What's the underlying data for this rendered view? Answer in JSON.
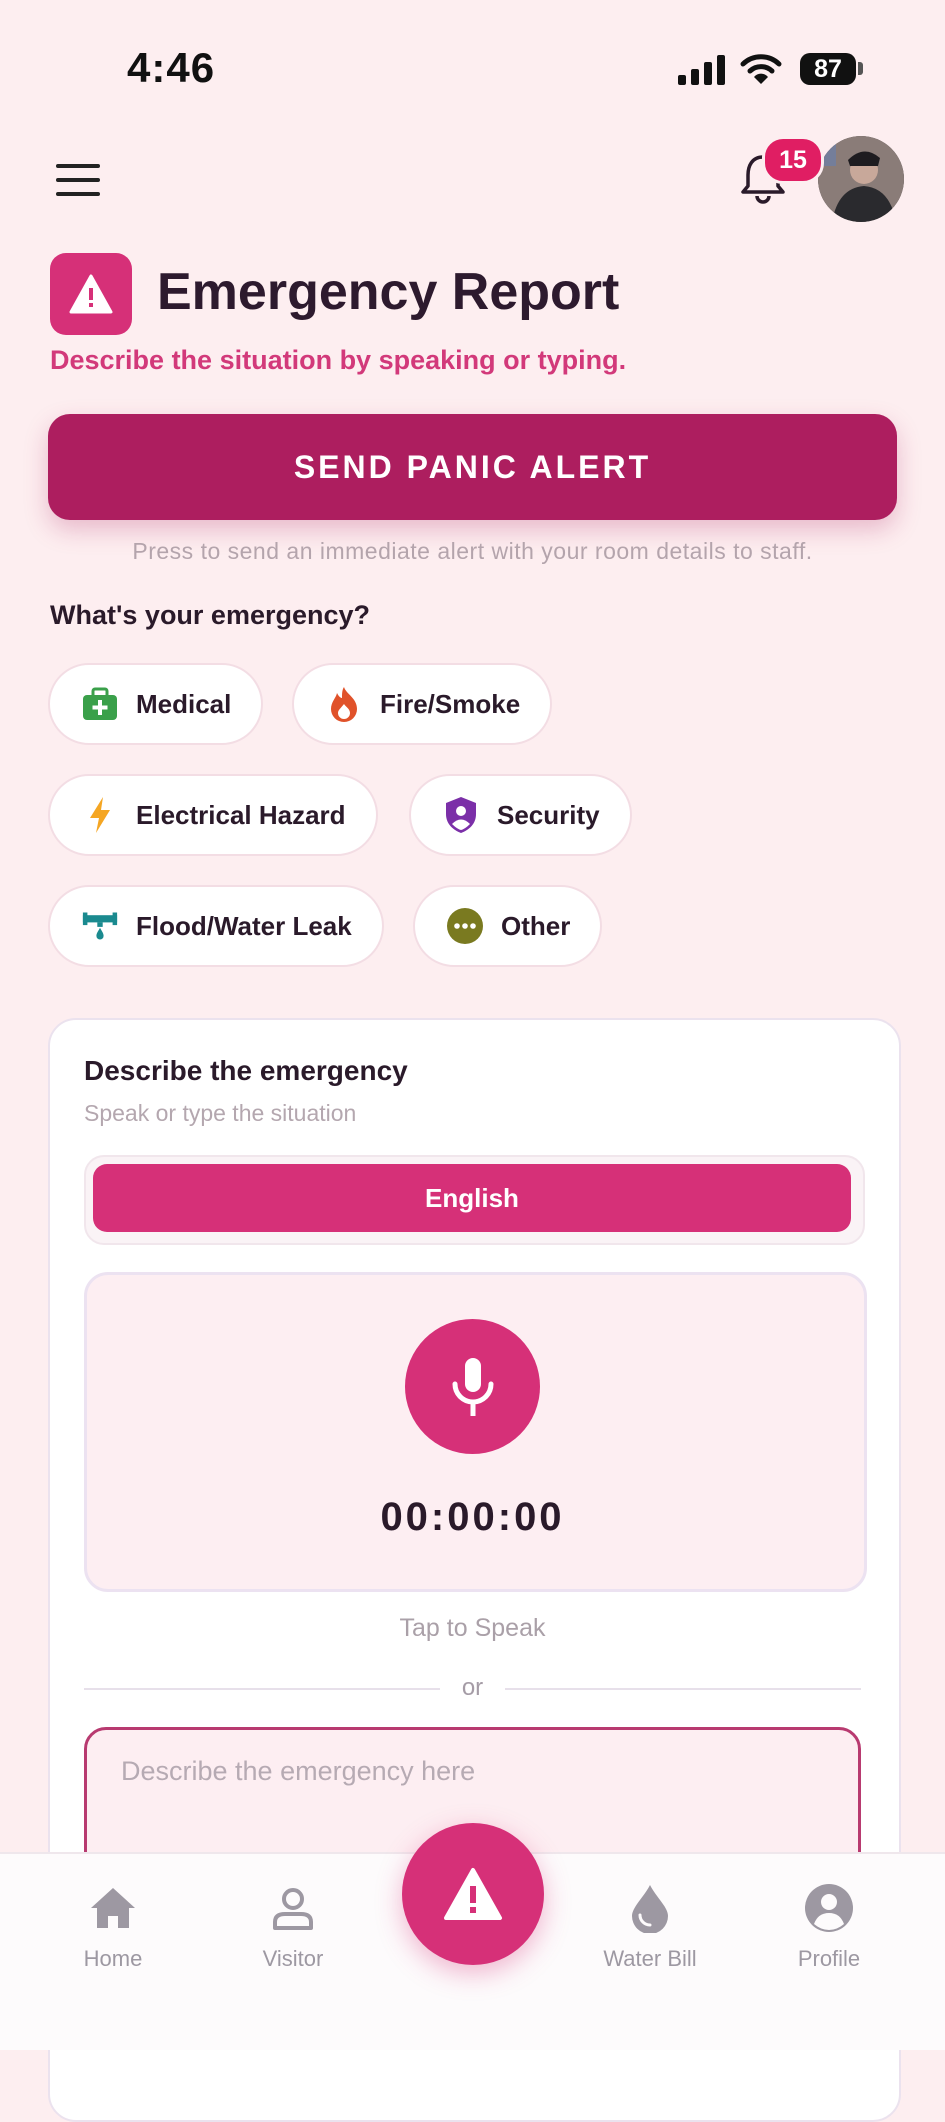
{
  "status_bar": {
    "time": "4:46",
    "battery": "87"
  },
  "header": {
    "notification_count": "15"
  },
  "page": {
    "title": "Emergency Report",
    "subtitle": "Describe the situation by speaking or typing."
  },
  "panic": {
    "button_label": "SEND PANIC ALERT",
    "hint": "Press to send an immediate alert with your room details to staff."
  },
  "emergency_types": {
    "question": "What's your emergency?",
    "options": [
      {
        "label": "Medical",
        "icon": "medical-kit-icon",
        "color": "#3aa04a"
      },
      {
        "label": "Fire/Smoke",
        "icon": "flame-icon",
        "color": "#e0522a"
      },
      {
        "label": "Electrical Hazard",
        "icon": "lightning-icon",
        "color": "#f5a623"
      },
      {
        "label": "Security",
        "icon": "shield-user-icon",
        "color": "#7b2fa8"
      },
      {
        "label": "Flood/Water Leak",
        "icon": "water-pipe-icon",
        "color": "#1a8a8f"
      },
      {
        "label": "Other",
        "icon": "more-dots-icon",
        "color": "#7a7a20"
      }
    ]
  },
  "description": {
    "title": "Describe the emergency",
    "subtitle": "Speak or type the situation",
    "language": "English",
    "timer": "00:00:00",
    "tap_hint": "Tap to Speak",
    "or_label": "or",
    "placeholder": "Describe the emergency here"
  },
  "bottom_nav": {
    "items": [
      {
        "label": "Home",
        "icon": "home-icon"
      },
      {
        "label": "Visitor",
        "icon": "user-icon"
      },
      {
        "label": "Water Bill",
        "icon": "water-drop-icon"
      },
      {
        "label": "Profile",
        "icon": "profile-icon"
      }
    ],
    "center_icon": "warning-icon"
  },
  "colors": {
    "accent": "#d63078",
    "panic": "#ad1e5f",
    "background": "#fdeef0"
  }
}
